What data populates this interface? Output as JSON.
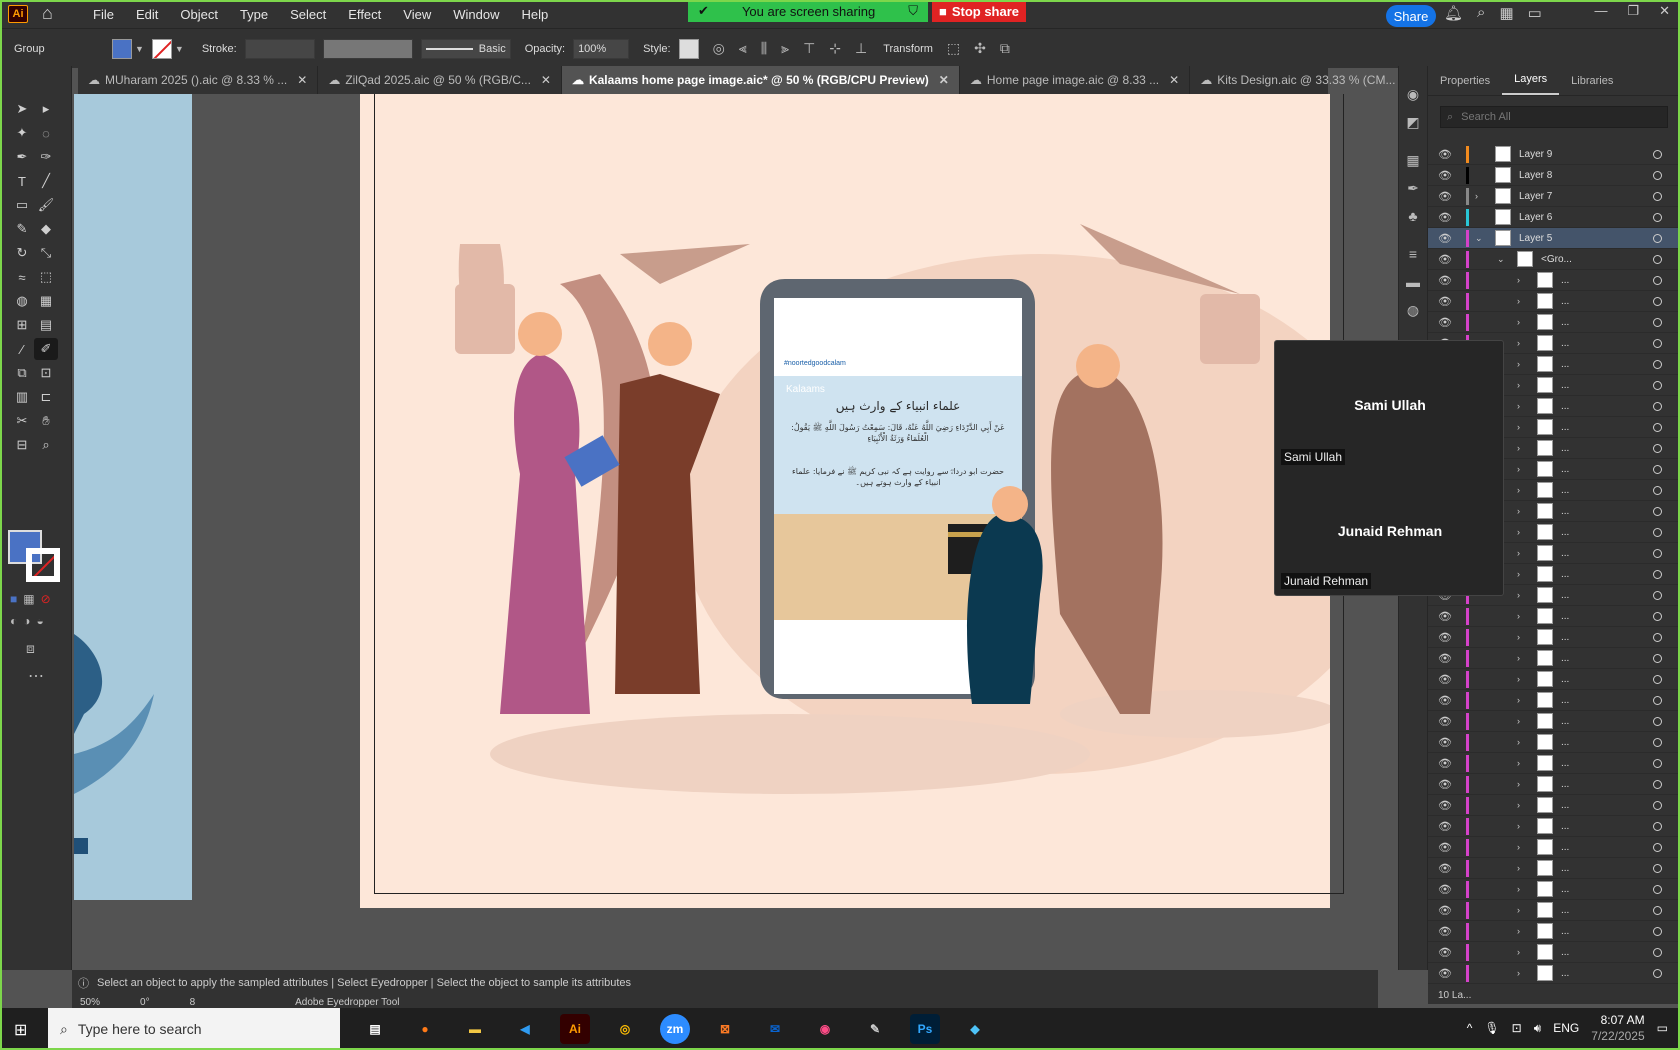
{
  "app": {
    "logo": "Ai"
  },
  "menu": [
    "File",
    "Edit",
    "Object",
    "Type",
    "Select",
    "Effect",
    "View",
    "Window",
    "Help"
  ],
  "sharing": {
    "banner": "You are screen sharing",
    "stop": "Stop share"
  },
  "share_button": "Share",
  "control_bar": {
    "selection": "Group",
    "stroke_label": "Stroke:",
    "brush": "Basic",
    "opacity_label": "Opacity:",
    "opacity_value": "100%",
    "style_label": "Style:",
    "transform": "Transform"
  },
  "tabs": [
    {
      "label": "MUharam 2025 ().aic @ 8.33 % ..."
    },
    {
      "label": "ZilQad 2025.aic @ 50 % (RGB/C..."
    },
    {
      "label": "Kalaams home page image.aic* @ 50 % (RGB/CPU Preview)"
    },
    {
      "label": "Home page image.aic @ 8.33 ..."
    },
    {
      "label": "Kits Design.aic @ 33.33 % (CM..."
    }
  ],
  "artwork": {
    "post_title_ur": "علماء انبیاء کے وارث ہیں",
    "post_brand": "Kalaams",
    "post_arabic": "عَنْ أَبِي الدَّرْدَاءِ رَضِيَ اللَّهُ عَنْهُ، قَالَ: سَمِعْتُ رَسُولَ اللَّهِ ﷺ يَقُولُ: الْعُلَمَاءُ وَرَثَةُ الْأَنْبِيَاءِ",
    "post_urdu": "حضرت ابو درداءؓ سے روایت ہے کہ نبی کریم ﷺ نے فرمایا: علماء انبیاء کے وارث ہوتے ہیں۔",
    "post_link": "#noortedgoodcalam"
  },
  "status": {
    "hint": "Select an object to apply the sampled attributes  |  Select Eyedropper  |  Select the object to sample its attributes",
    "zoom": "50%",
    "rotation": "0°",
    "artboard": "8",
    "tool": "Adobe Eyedropper Tool"
  },
  "panel": {
    "tabs": [
      "Properties",
      "Layers",
      "Libraries"
    ],
    "search_placeholder": "Search All",
    "layers": [
      {
        "name": "Layer 9",
        "color": "#f28b1e"
      },
      {
        "name": "Layer 8",
        "color": "#000000"
      },
      {
        "name": "Layer 7",
        "color": "#888888"
      },
      {
        "name": "Layer 6",
        "color": "#29c6d6"
      },
      {
        "name": "Layer 5",
        "color": "#d442c9"
      },
      {
        "name": "<Gro...",
        "color": "#d442c9"
      }
    ],
    "sublayer_label": "...",
    "footer": "10 La..."
  },
  "participants": [
    {
      "name": "Sami Ullah",
      "tag": "Sami Ullah"
    },
    {
      "name": "Junaid Rehman",
      "tag": "Junaid Rehman"
    }
  ],
  "taskbar": {
    "search": "Type here to search",
    "apps": [
      {
        "label": "Ai",
        "color": "#330000",
        "fg": "#ff9a00"
      },
      {
        "label": "zm",
        "color": "#2d8cff",
        "fg": "#ffffff"
      },
      {
        "label": "Ps",
        "color": "#001e36",
        "fg": "#31a8ff"
      }
    ],
    "time": "8:07 AM",
    "date": "7/22/2025"
  }
}
